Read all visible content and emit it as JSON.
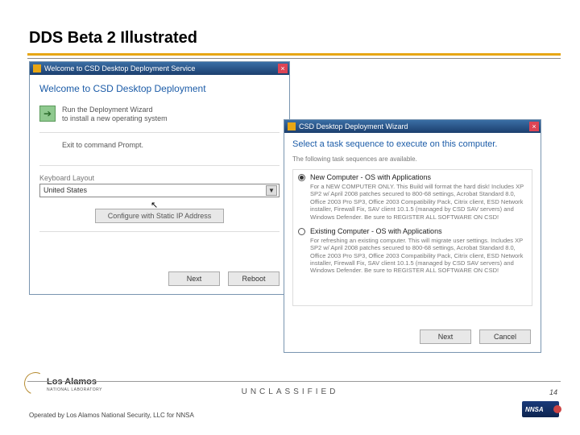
{
  "slide": {
    "title": "DDS Beta 2 Illustrated",
    "number": "14"
  },
  "footer": {
    "classification": "UNCLASSIFIED",
    "operated": "Operated by Los Alamos National Security, LLC for NNSA",
    "lab_name": "Los Alamos",
    "lab_sub": "NATIONAL LABORATORY",
    "nnsa": "NNSA"
  },
  "win1": {
    "title": "Welcome to CSD Desktop Deployment Service",
    "close": "×",
    "heading": "Welcome to CSD Desktop Deployment",
    "run_line1": "Run the Deployment Wizard",
    "run_line2": "to install a new operating system",
    "exit": "Exit to command Prompt.",
    "kb_label": "Keyboard Layout",
    "kb_value": "United States",
    "kb_arrow": "▼",
    "configure": "Configure with Static IP Address",
    "next": "Next",
    "reboot": "Reboot"
  },
  "win2": {
    "title": "CSD Desktop Deployment Wizard",
    "close": "×",
    "heading": "Select a task sequence to execute on this computer.",
    "sub": "The following task sequences are available.",
    "opt1_title": "New Computer - OS with Applications",
    "opt1_desc": "For a NEW COMPUTER ONLY. This Build will format the hard disk! Includes XP SP2 w/ April 2008 patches secured to 800-68 settings, Acrobat Standard 8.0, Office 2003 Pro SP3, Office 2003 Compatibility Pack, Citrix client, ESD Network installer, Firewall Fix, SAV client 10.1.5 (managed by CSD SAV servers) and Windows Defender. Be sure to REGISTER ALL SOFTWARE ON CSD!",
    "opt2_title": "Existing Computer - OS with Applications",
    "opt2_desc": "For refreshing an existing computer. This will migrate user settings. Includes XP SP2 w/ April 2008 patches secured to 800-68 settings, Acrobat Standard 8.0, Office 2003 Pro SP3, Office 2003 Compatibility Pack, Citrix client, ESD Network installer, Firewall Fix, SAV client 10.1.5 (managed by CSD SAV servers) and Windows Defender. Be sure to REGISTER ALL SOFTWARE ON CSD!",
    "next": "Next",
    "cancel": "Cancel"
  }
}
